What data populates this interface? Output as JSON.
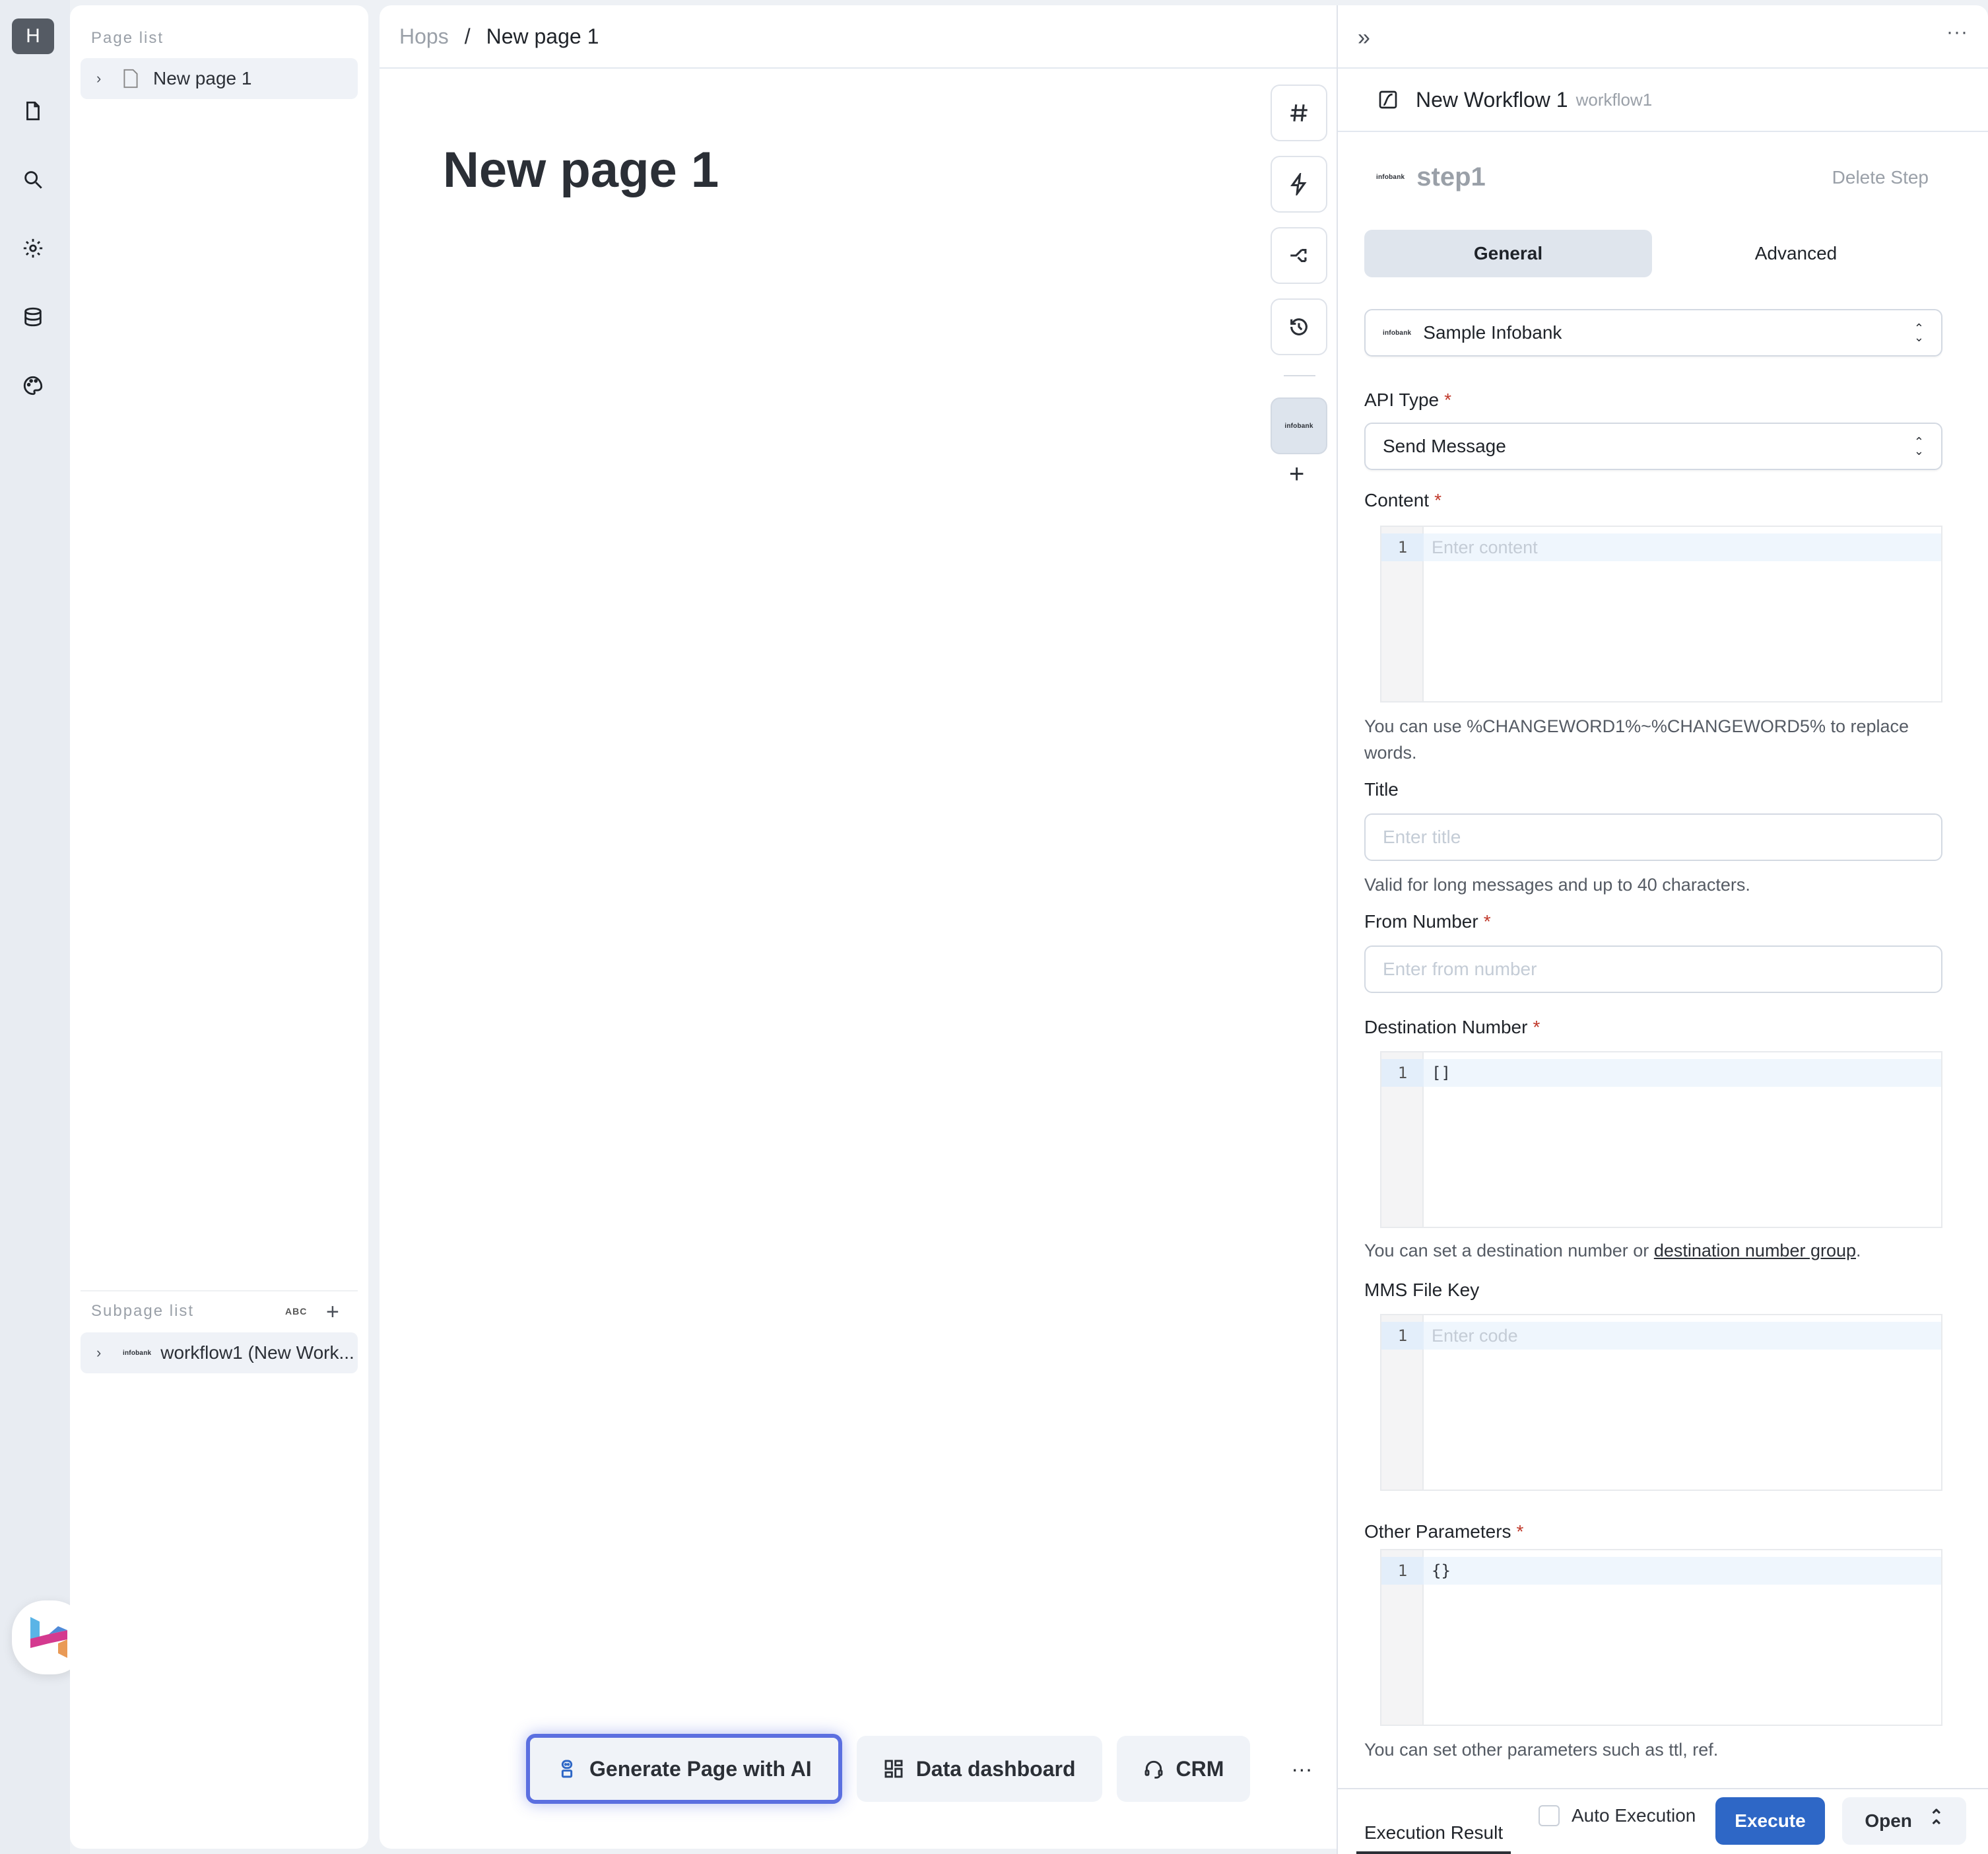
{
  "rail": {
    "workspace_initial": "H",
    "icons": [
      "document-icon",
      "search-icon",
      "gear-icon",
      "database-icon",
      "palette-icon"
    ]
  },
  "page_list": {
    "label": "Page list",
    "items": [
      {
        "label": "New page 1"
      }
    ]
  },
  "subpage_list": {
    "label": "Subpage list",
    "sort_label": "ABC",
    "items": [
      {
        "icon_text": "infobank",
        "label": "workflow1 (New Work..."
      }
    ]
  },
  "breadcrumb": {
    "root": "Hops",
    "separator": "/",
    "current": "New page 1"
  },
  "page_title": "New page 1",
  "toolbar": {
    "active_integration_label": "infobank"
  },
  "quick_actions": [
    {
      "label": "Generate Page with AI"
    },
    {
      "label": "Data dashboard"
    },
    {
      "label": "CRM"
    }
  ],
  "quick_more": "···",
  "right_panel": {
    "more": "···",
    "workflow_title": "New Workflow 1",
    "workflow_id": "workflow1",
    "step_logo": "infobank",
    "step_name": "step1",
    "delete_step": "Delete Step",
    "tabs": [
      {
        "label": "General",
        "active": true
      },
      {
        "label": "Advanced",
        "active": false
      }
    ],
    "connection": {
      "logo": "infobank",
      "value": "Sample Infobank"
    },
    "api_type": {
      "label": "API Type",
      "value": "Send Message"
    },
    "content": {
      "label": "Content",
      "line": "1",
      "placeholder": "Enter content",
      "help": "You can use %CHANGEWORD1%~%CHANGEWORD5% to replace words."
    },
    "title": {
      "label": "Title",
      "placeholder": "Enter title",
      "value": "",
      "help": "Valid for long messages and up to 40 characters."
    },
    "from_number": {
      "label": "From Number",
      "placeholder": "Enter from number",
      "value": ""
    },
    "destination_number": {
      "label": "Destination Number",
      "line": "1",
      "value": "[]",
      "help_prefix": "You can set a destination number or",
      "help_link": "destination number group",
      "help_suffix": "."
    },
    "mms_file_key": {
      "label": "MMS File Key",
      "line": "1",
      "placeholder": "Enter code"
    },
    "other_parameters": {
      "label": "Other Parameters",
      "line": "1",
      "value": "{}",
      "help": "You can set other parameters such as ttl, ref."
    },
    "required_mark": "*",
    "bottom": {
      "execution_result": "Execution Result",
      "auto_execution": "Auto Execution",
      "auto_execution_checked": false,
      "execute": "Execute",
      "open": "Open"
    }
  },
  "colors": {
    "accent": "#2e67c6",
    "ai_glow": "#5b6fe0",
    "required": "#c0392b"
  }
}
